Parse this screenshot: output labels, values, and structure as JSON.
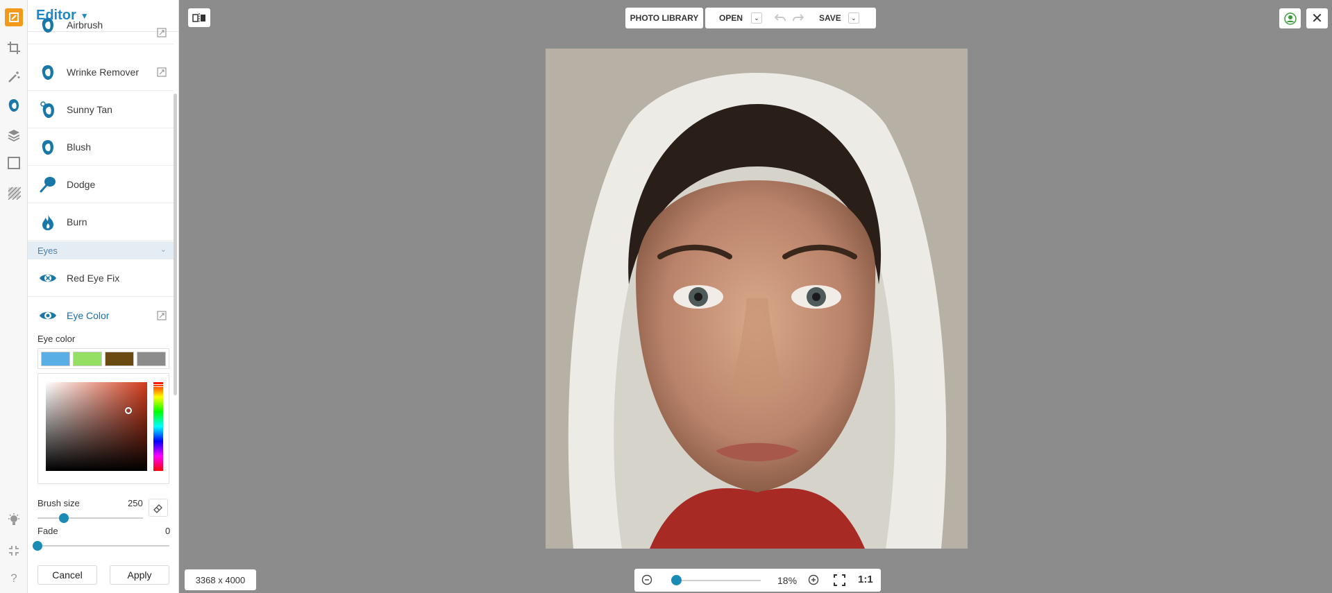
{
  "panel": {
    "title": "Editor",
    "tools": [
      {
        "label": "Airbrush",
        "icon": "face-airbrush-icon"
      },
      {
        "label": "Wrinke Remover",
        "icon": "face-wrinkle-icon"
      },
      {
        "label": "Sunny Tan",
        "icon": "face-tan-icon"
      },
      {
        "label": "Blush",
        "icon": "face-blush-icon"
      },
      {
        "label": "Dodge",
        "icon": "dodge-icon"
      },
      {
        "label": "Burn",
        "icon": "flame-icon"
      }
    ],
    "section_eyes": "Eyes",
    "red_eye_fix": "Red Eye Fix",
    "eye_color_tool": "Eye Color",
    "eye_color_label": "Eye color",
    "swatches": [
      "#5aaee6",
      "#95e062",
      "#6b4a12",
      "#8c8c8c"
    ],
    "brush_size_label": "Brush size",
    "brush_size_value": "250",
    "brush_size_level": 0.25,
    "fade_label": "Fade",
    "fade_value": "0",
    "fade_level": 0,
    "cancel": "Cancel",
    "apply": "Apply"
  },
  "toolbar": {
    "photo_library": "PHOTO LIBRARY",
    "open": "OPEN",
    "save": "SAVE"
  },
  "status": {
    "dimensions": "3368 x 4000",
    "zoom_percent": "18%",
    "one_to_one": "1:1"
  },
  "colors": {
    "accent": "#1e87c8",
    "logo": "#f39a1c",
    "canvas_bg": "#8c8c8c"
  }
}
